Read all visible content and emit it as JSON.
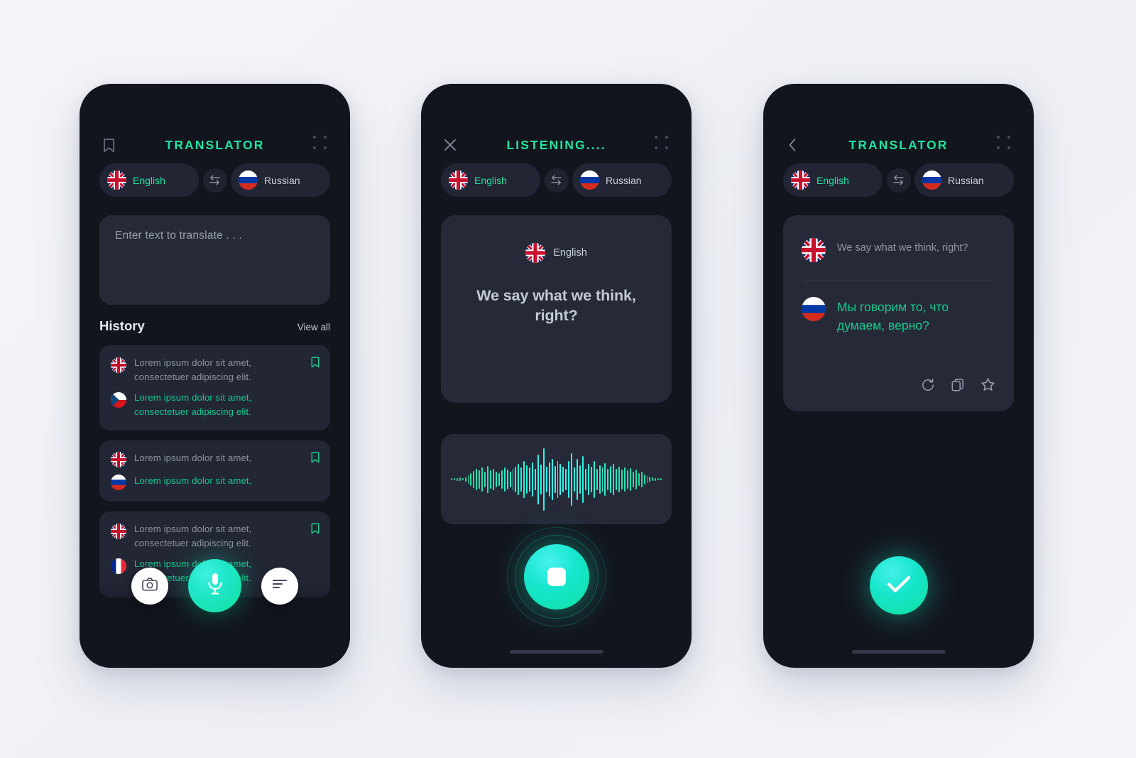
{
  "accent": "#1fe3a0",
  "screens": [
    {
      "id": "home",
      "header": {
        "left_icon": "bookmark-icon",
        "title": "TRANSLATOR",
        "right_icon": "grid-menu-icon"
      },
      "languages": {
        "source": "English",
        "target": "Russian",
        "swap_icon": "swap-icon"
      },
      "input": {
        "placeholder": "Enter text to translate . . ."
      },
      "history": {
        "title": "History",
        "view_all": "View all",
        "items": [
          {
            "source_flag": "uk",
            "source_text": "Lorem ipsum dolor sit amet, consectetuer adipiscing elit.",
            "target_flag": "cz",
            "target_text": "Lorem ipsum dolor sit amet, consectetuer adipiscing elit.",
            "bookmark": "bookmark-icon"
          },
          {
            "source_flag": "uk",
            "source_text": "Lorem ipsum dolor sit amet,",
            "target_flag": "ru",
            "target_text": "Lorem ipsum dolor sit amet,",
            "bookmark": "bookmark-icon"
          },
          {
            "source_flag": "uk",
            "source_text": "Lorem ipsum dolor sit amet, consectetuer adipiscing elit.",
            "target_flag": "fr",
            "target_text": "Lorem ipsum dolor sit amet, consectetuer adipiscing elit.",
            "bookmark": "bookmark-icon"
          }
        ]
      },
      "bottom_bar": {
        "camera_icon": "camera-icon",
        "mic_icon": "microphone-icon",
        "text_icon": "text-lines-icon"
      }
    },
    {
      "id": "listening",
      "header": {
        "left_icon": "close-icon",
        "title": "LISTENING....",
        "right_icon": "grid-menu-icon"
      },
      "languages": {
        "source": "English",
        "target": "Russian",
        "swap_icon": "swap-icon"
      },
      "listen_card": {
        "lang_flag": "uk",
        "lang_label": "English",
        "text": "We say what we think, right?"
      },
      "waveform": {
        "label": "audio-waveform",
        "bars": [
          2,
          3,
          4,
          5,
          3,
          6,
          12,
          18,
          24,
          30,
          26,
          34,
          22,
          38,
          26,
          30,
          22,
          18,
          26,
          34,
          28,
          22,
          30,
          36,
          44,
          34,
          52,
          40,
          34,
          48,
          30,
          70,
          42,
          88,
          36,
          48,
          58,
          38,
          52,
          44,
          36,
          30,
          52,
          74,
          34,
          58,
          40,
          66,
          30,
          44,
          36,
          52,
          30,
          40,
          34,
          46,
          30,
          38,
          44,
          30,
          36,
          28,
          34,
          26,
          32,
          22,
          28,
          18,
          22,
          14,
          10,
          7,
          5,
          4,
          3,
          2
        ]
      },
      "stop_button": {
        "icon": "stop-square-icon"
      }
    },
    {
      "id": "result",
      "header": {
        "left_icon": "back-chevron-icon",
        "title": "TRANSLATOR",
        "right_icon": "grid-menu-icon"
      },
      "languages": {
        "source": "English",
        "target": "Russian",
        "swap_icon": "swap-icon"
      },
      "result": {
        "source_flag": "uk",
        "source_text": "We say what we think, right?",
        "target_flag": "ru",
        "target_text": "Мы говорим то, что думаем, верно?",
        "actions": [
          "refresh-icon",
          "copy-icon",
          "star-icon"
        ]
      },
      "confirm_button": {
        "icon": "check-icon"
      }
    }
  ]
}
